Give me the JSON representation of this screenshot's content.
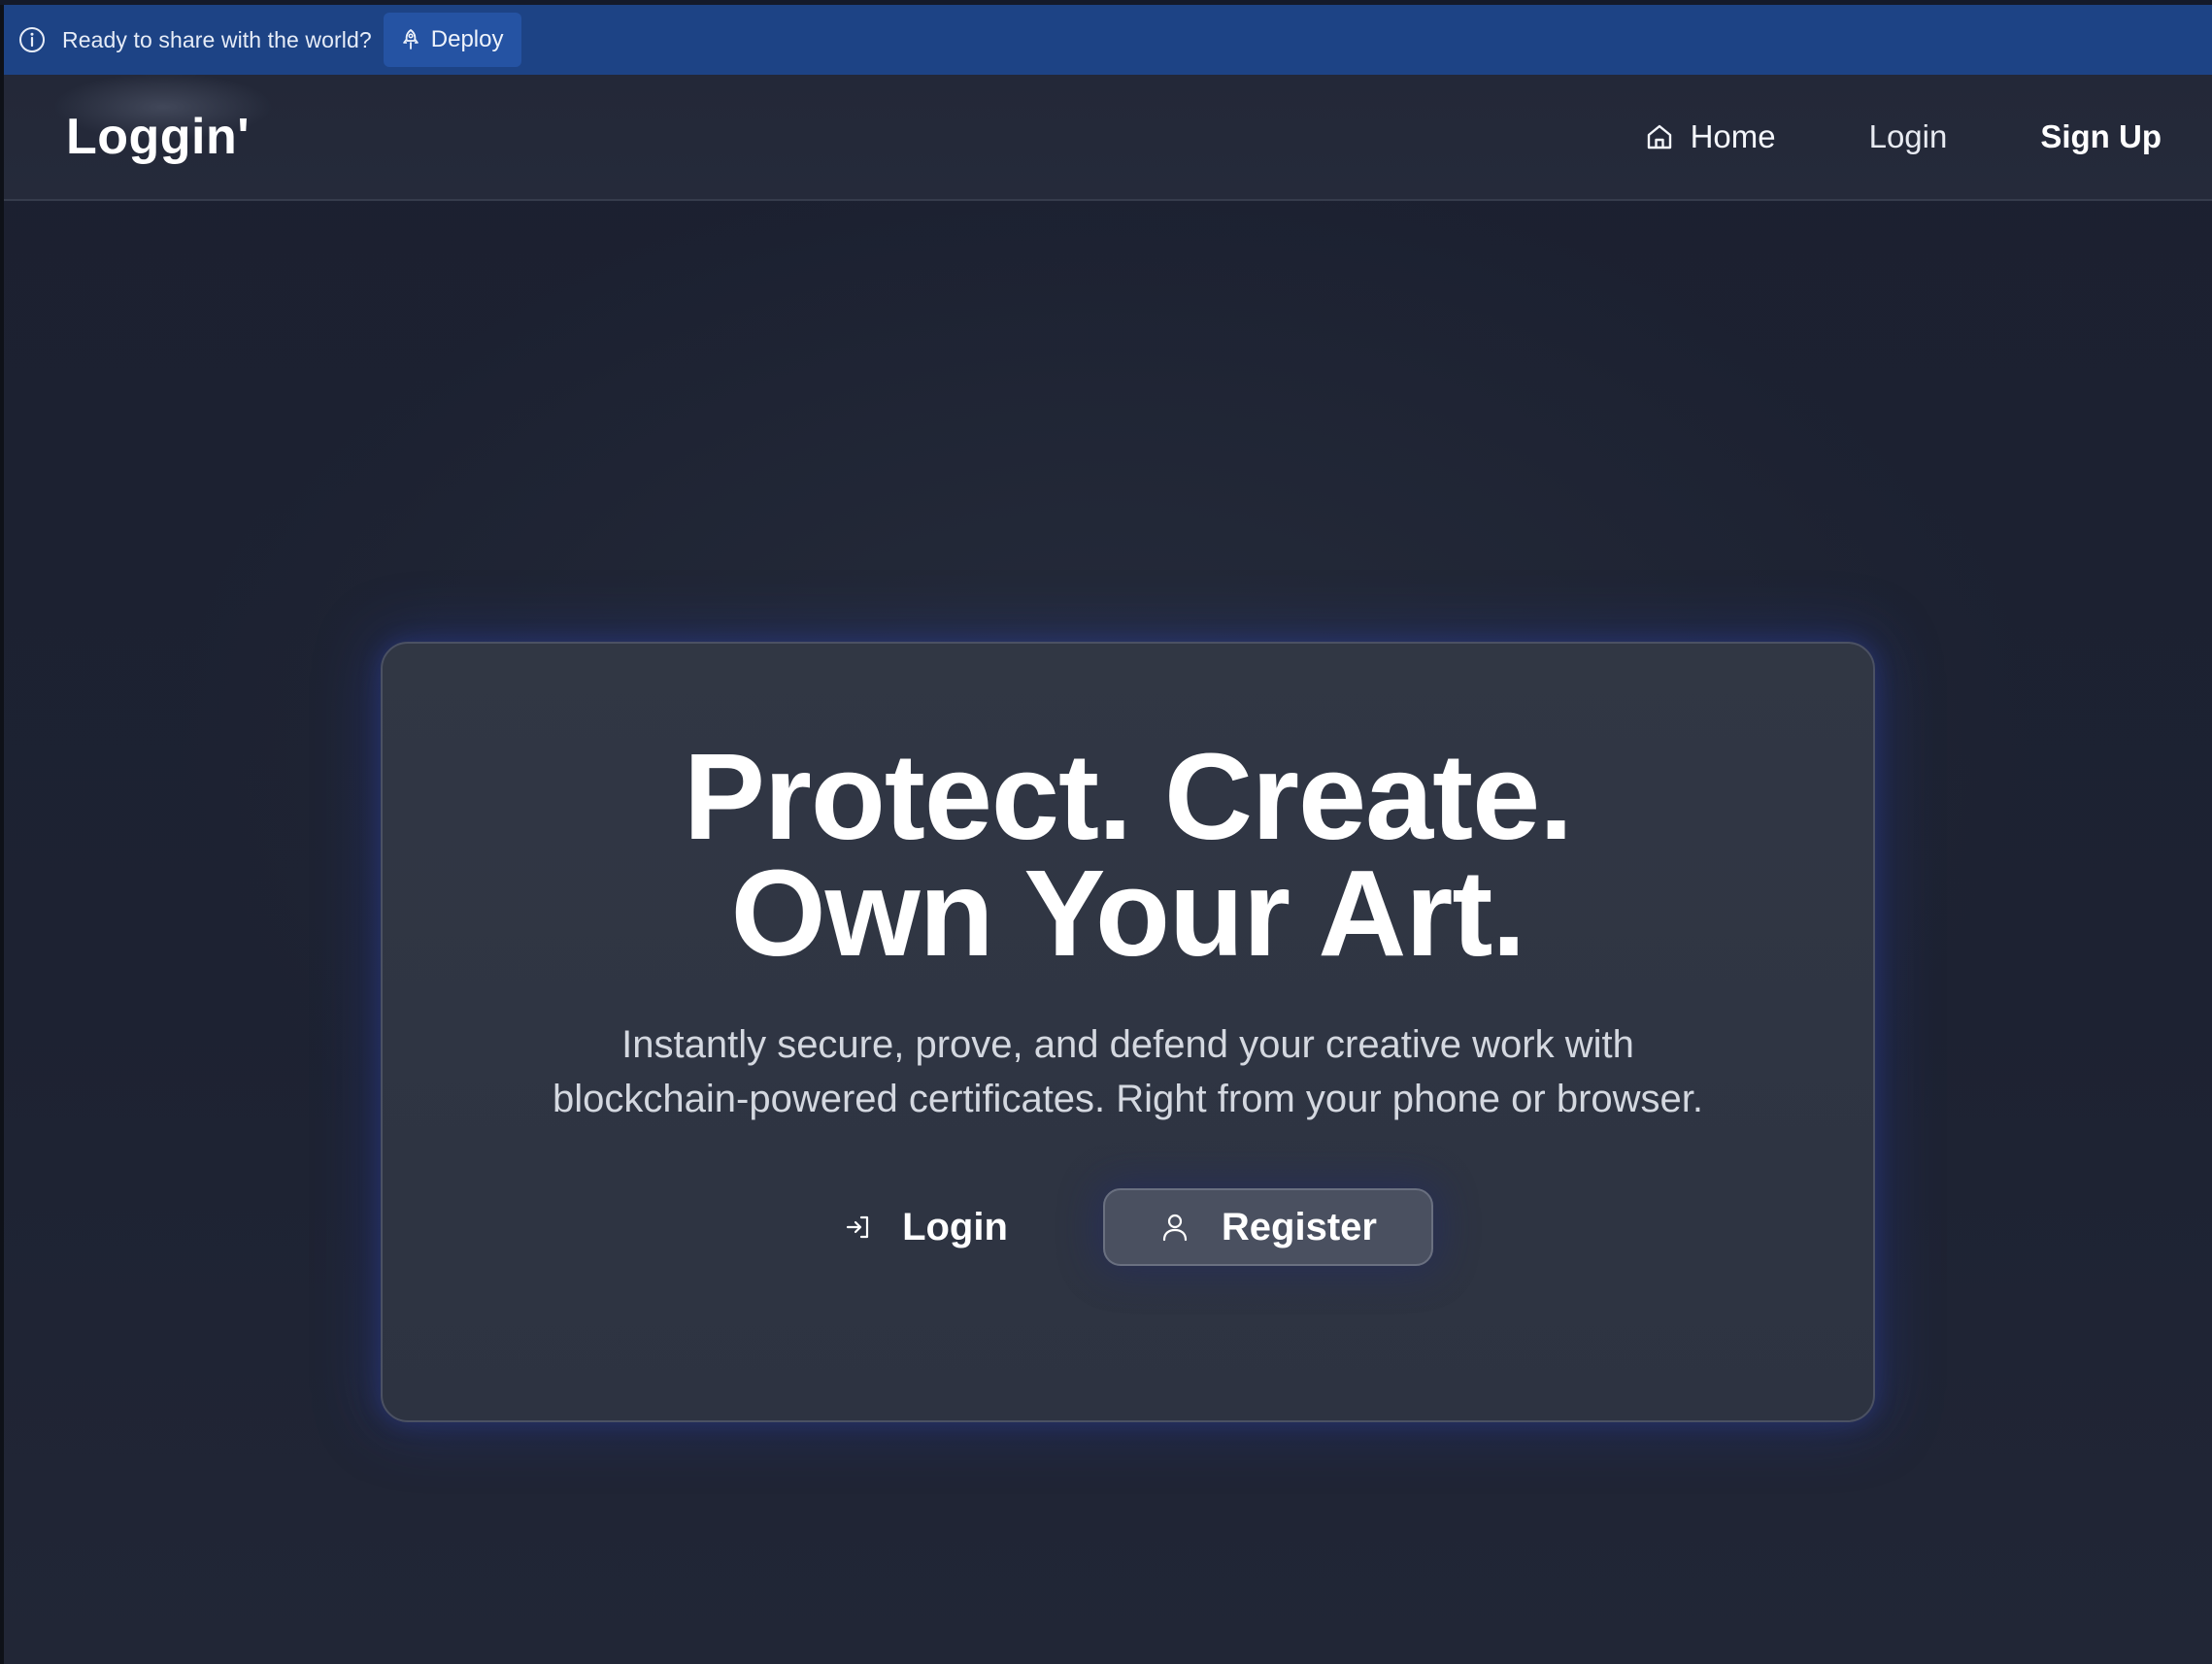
{
  "banner": {
    "info_icon": "info-circle-icon",
    "text": "Ready to share with the world?",
    "deploy_icon": "rocket-icon",
    "deploy_label": "Deploy",
    "colors": {
      "background": "#1d4385",
      "button": "#2553a3"
    }
  },
  "navbar": {
    "logo": "Loggin'",
    "links": {
      "home_icon": "home-icon",
      "home": "Home",
      "login": "Login",
      "signup": "Sign Up"
    }
  },
  "hero": {
    "title_line1": "Protect. Create.",
    "title_line2": "Own Your Art.",
    "subtitle_line1": "Instantly secure, prove, and defend your creative work with",
    "subtitle_line2": "blockchain-powered certificates. Right from your phone or browser.",
    "login_icon": "log-in-icon",
    "login_label": "Login",
    "register_icon": "user-icon",
    "register_label": "Register"
  },
  "colors": {
    "page_background": "#1c2130",
    "card_background": "#313744",
    "card_glow": "#2a3ca0",
    "register_button": "#4a5060"
  }
}
